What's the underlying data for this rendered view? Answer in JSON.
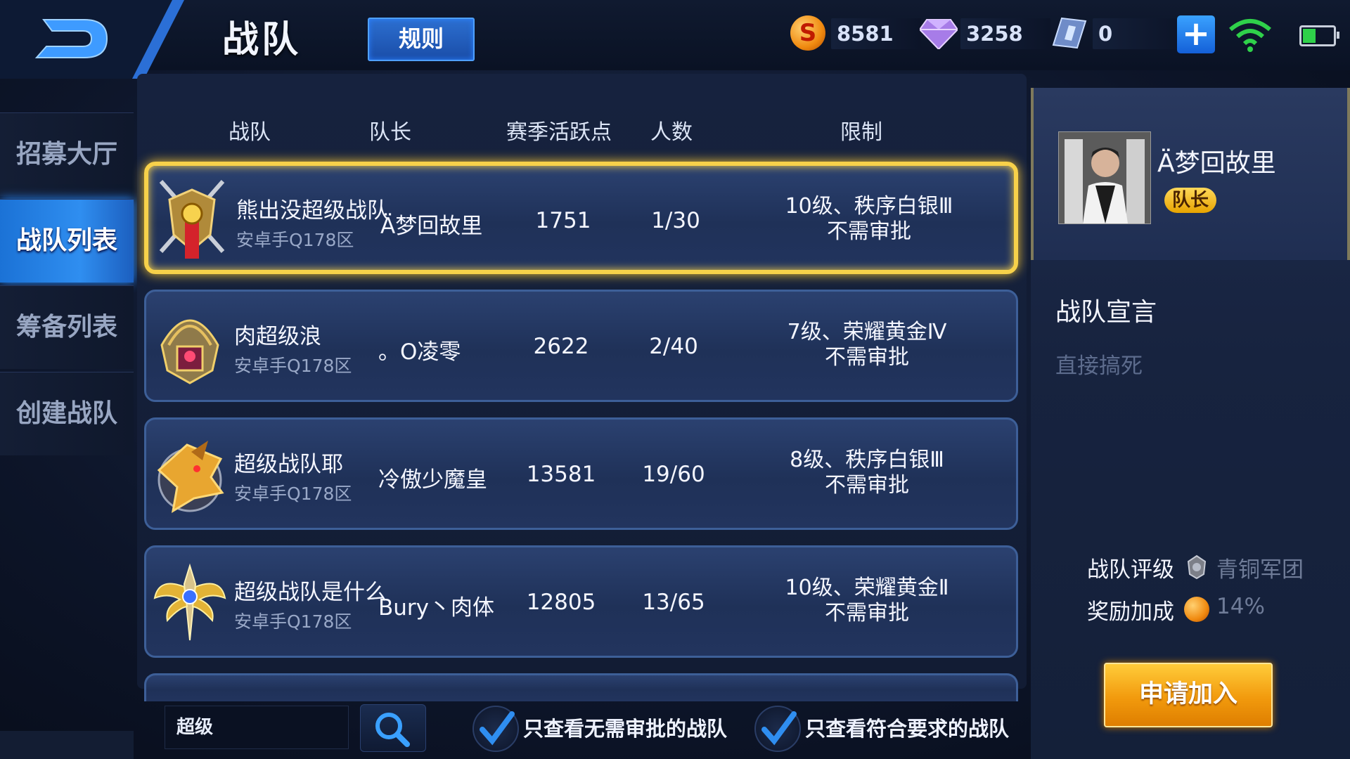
{
  "header": {
    "title": "战队",
    "rules_label": "规则",
    "gold": "8581",
    "diamond": "3258",
    "coupon": "0"
  },
  "sidebar": {
    "items": [
      {
        "label": "招募大厅",
        "active": false
      },
      {
        "label": "战队列表",
        "active": true
      },
      {
        "label": "筹备列表",
        "active": false
      },
      {
        "label": "创建战队",
        "active": false
      }
    ]
  },
  "table": {
    "headers": {
      "team": "战队",
      "captain": "队长",
      "points": "赛季活跃点",
      "members": "人数",
      "limit": "限制"
    },
    "rows": [
      {
        "name": "熊出没超级战队",
        "server": "安卓手Q178区",
        "captain": "Ä梦回故里",
        "points": "1751",
        "members": "1/30",
        "limit": "10级、秩序白银Ⅲ",
        "approval": "不需审批",
        "emblem": "crossed-swords-shield-emblem"
      },
      {
        "name": "肉超级浪",
        "server": "安卓手Q178区",
        "captain": "。O凌零",
        "points": "2622",
        "members": "2/40",
        "limit": "7级、荣耀黄金Ⅳ",
        "approval": "不需审批",
        "emblem": "golden-helmet-emblem"
      },
      {
        "name": "超级战队耶",
        "server": "安卓手Q178区",
        "captain": "冷傲少魔皇",
        "points": "13581",
        "members": "19/60",
        "limit": "8级、秩序白银Ⅲ",
        "approval": "不需审批",
        "emblem": "dragon-head-emblem"
      },
      {
        "name": "超级战队是什么",
        "server": "安卓手Q178区",
        "captain": "Bury丶肉体",
        "points": "12805",
        "members": "13/65",
        "limit": "10级、荣耀黄金Ⅱ",
        "approval": "不需审批",
        "emblem": "winged-gold-emblem"
      }
    ]
  },
  "search": {
    "value": "超级"
  },
  "filters": {
    "no_approval": "只查看无需审批的战队",
    "meets_requirements": "只查看符合要求的战队"
  },
  "panel": {
    "captain_name": "Ä梦回故里",
    "captain_badge": "队长",
    "declaration_title": "战队宣言",
    "declaration_text": "直接搞死",
    "rating_label": "战队评级",
    "rating_value": "青铜军团",
    "bonus_label": "奖励加成",
    "bonus_value": "14%",
    "apply_label": "申请加入"
  },
  "colors": {
    "accent_blue": "#2f8ef0",
    "selected_gold": "#f7d14a",
    "apply_orange": "#f29a0d"
  }
}
